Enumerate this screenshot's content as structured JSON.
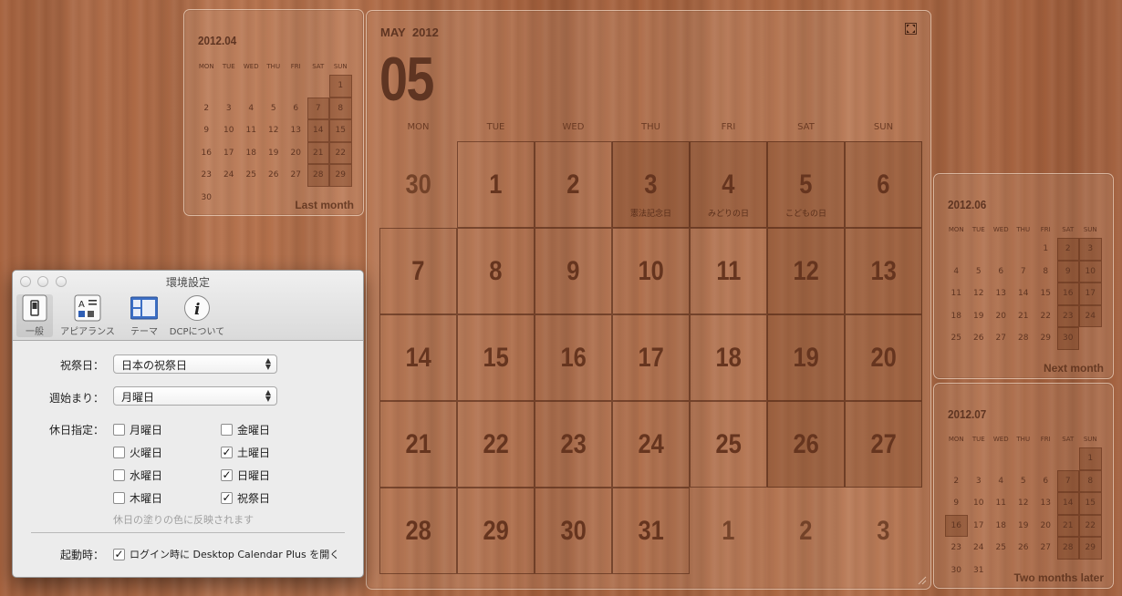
{
  "last_month": {
    "title": "2012.04",
    "caption": "Last month",
    "dow": [
      "MON",
      "TUE",
      "WED",
      "THU",
      "FRI",
      "SAT",
      "SUN"
    ],
    "days": [
      "",
      "",
      "",
      "",
      "",
      "",
      "1",
      "2",
      "3",
      "4",
      "5",
      "6",
      "7",
      "8",
      "9",
      "10",
      "11",
      "12",
      "13",
      "14",
      "15",
      "16",
      "17",
      "18",
      "19",
      "20",
      "21",
      "22",
      "23",
      "24",
      "25",
      "26",
      "27",
      "28",
      "29",
      "30"
    ]
  },
  "main": {
    "month_label": "MAY",
    "year_label": "2012",
    "big_number": "05",
    "dow": [
      "MON",
      "TUE",
      "WED",
      "THU",
      "FRI",
      "SAT",
      "SUN"
    ],
    "days": [
      {
        "n": "30"
      },
      {
        "n": "1"
      },
      {
        "n": "2"
      },
      {
        "n": "3",
        "h": "憲法記念日"
      },
      {
        "n": "4",
        "h": "みどりの日"
      },
      {
        "n": "5",
        "h": "こどもの日"
      },
      {
        "n": "6"
      },
      {
        "n": "7"
      },
      {
        "n": "8"
      },
      {
        "n": "9"
      },
      {
        "n": "10"
      },
      {
        "n": "11"
      },
      {
        "n": "12"
      },
      {
        "n": "13"
      },
      {
        "n": "14"
      },
      {
        "n": "15"
      },
      {
        "n": "16"
      },
      {
        "n": "17"
      },
      {
        "n": "18"
      },
      {
        "n": "19"
      },
      {
        "n": "20"
      },
      {
        "n": "21"
      },
      {
        "n": "22"
      },
      {
        "n": "23"
      },
      {
        "n": "24"
      },
      {
        "n": "25"
      },
      {
        "n": "26"
      },
      {
        "n": "27"
      },
      {
        "n": "28"
      },
      {
        "n": "29"
      },
      {
        "n": "30"
      },
      {
        "n": "31"
      },
      {
        "n": "1"
      },
      {
        "n": "2"
      },
      {
        "n": "3"
      }
    ]
  },
  "next_month": {
    "title": "2012.06",
    "caption": "Next month",
    "dow": [
      "MON",
      "TUE",
      "WED",
      "THU",
      "FRI",
      "SAT",
      "SUN"
    ],
    "days": [
      "",
      "",
      "",
      "",
      "1",
      "2",
      "3",
      "4",
      "5",
      "6",
      "7",
      "8",
      "9",
      "10",
      "11",
      "12",
      "13",
      "14",
      "15",
      "16",
      "17",
      "18",
      "19",
      "20",
      "21",
      "22",
      "23",
      "24",
      "25",
      "26",
      "27",
      "28",
      "29",
      "30"
    ]
  },
  "two_months": {
    "title": "2012.07",
    "caption": "Two months later",
    "dow": [
      "MON",
      "TUE",
      "WED",
      "THU",
      "FRI",
      "SAT",
      "SUN"
    ],
    "days": [
      "",
      "",
      "",
      "",
      "",
      "",
      "1",
      "2",
      "3",
      "4",
      "5",
      "6",
      "7",
      "8",
      "9",
      "10",
      "11",
      "12",
      "13",
      "14",
      "15",
      "16",
      "17",
      "18",
      "19",
      "20",
      "21",
      "22",
      "23",
      "24",
      "25",
      "26",
      "27",
      "28",
      "29",
      "30",
      "31"
    ]
  },
  "prefs": {
    "title": "環境設定",
    "toolbar": [
      "一般",
      "アピアランス",
      "テーマ",
      "DCPについて"
    ],
    "holiday_label": "祝祭日：",
    "holiday_value": "日本の祝祭日",
    "week_start_label": "週始まり：",
    "week_start_value": "月曜日",
    "days_off_label": "休日指定：",
    "checkboxes": [
      {
        "label": "月曜日",
        "checked": false
      },
      {
        "label": "火曜日",
        "checked": false
      },
      {
        "label": "水曜日",
        "checked": false
      },
      {
        "label": "木曜日",
        "checked": false
      },
      {
        "label": "金曜日",
        "checked": false
      },
      {
        "label": "土曜日",
        "checked": true
      },
      {
        "label": "日曜日",
        "checked": true
      },
      {
        "label": "祝祭日",
        "checked": true
      }
    ],
    "note": "休日の塗りの色に反映されます",
    "startup_label": "起動時：",
    "startup_option": "ログイン時に Desktop Calendar Plus を開く",
    "startup_checked": true
  }
}
